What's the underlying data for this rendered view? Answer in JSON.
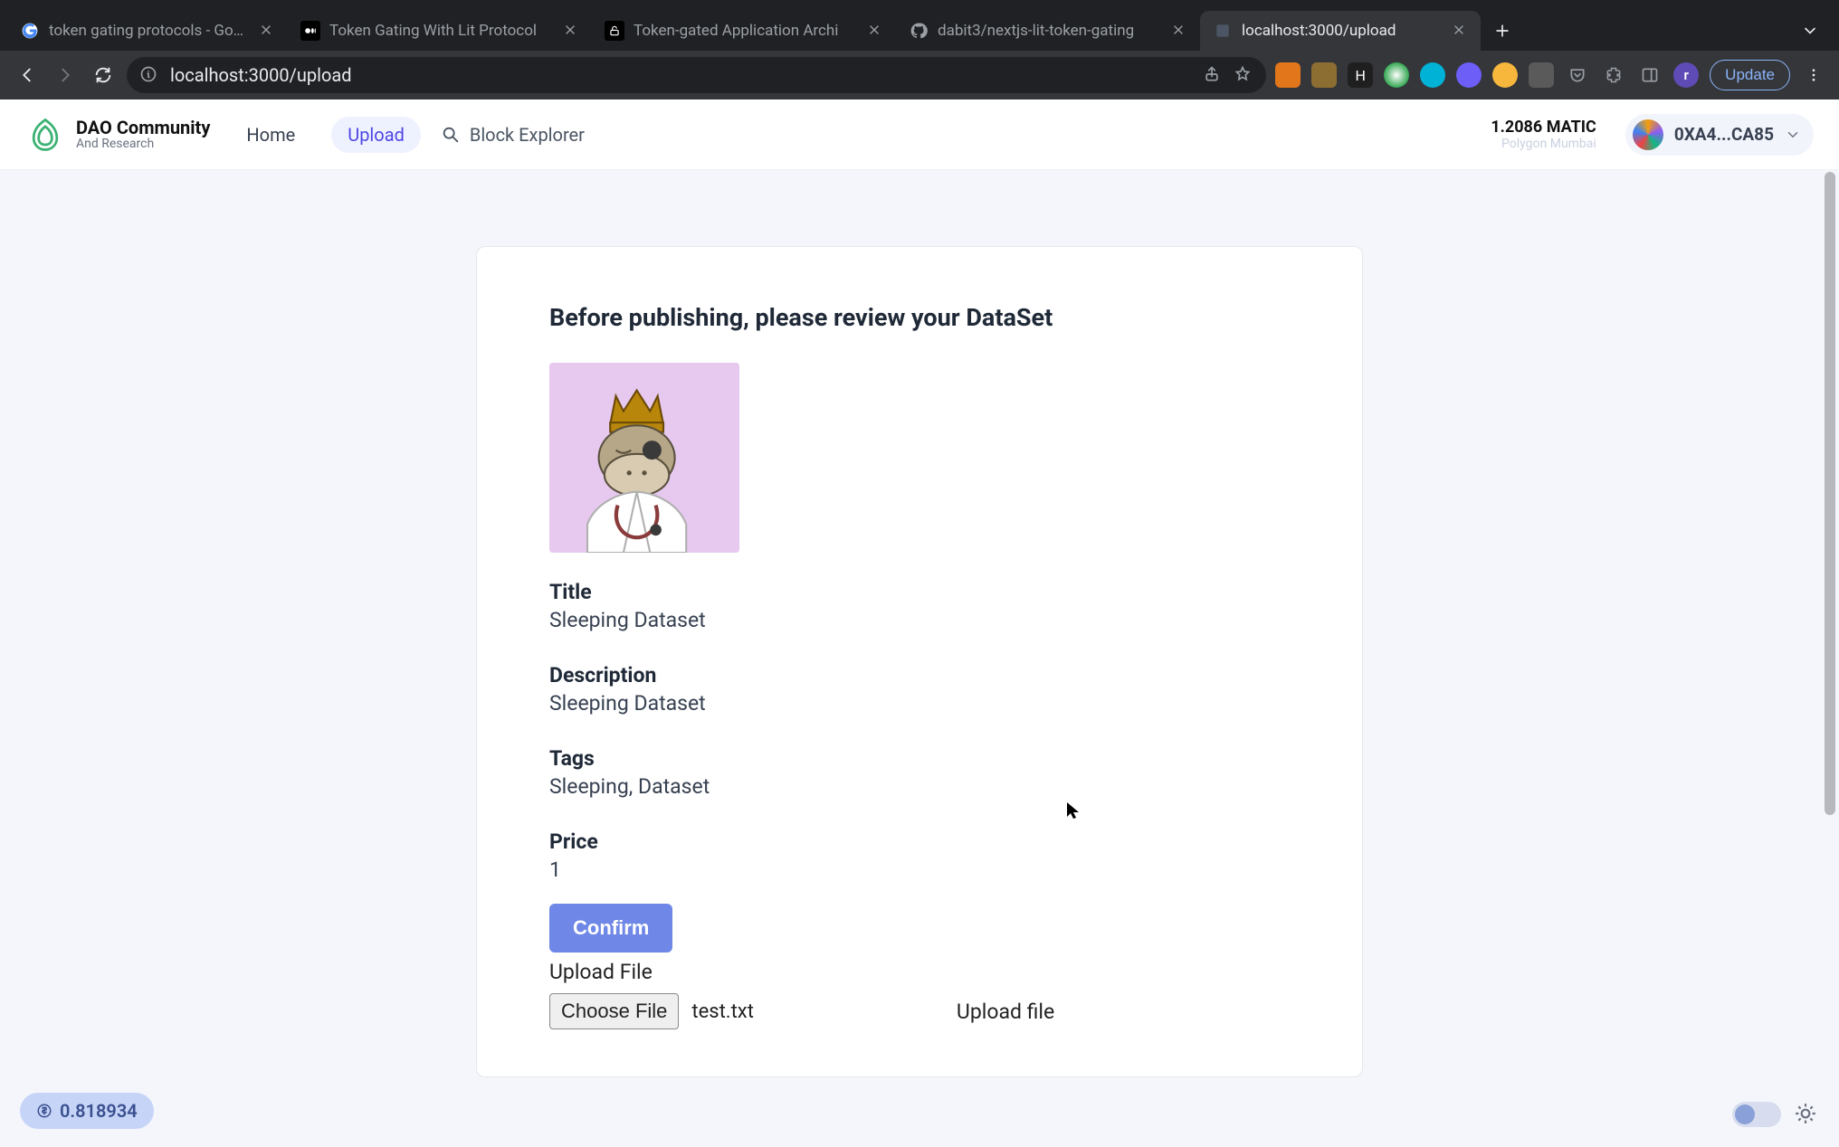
{
  "browser": {
    "tabs": [
      {
        "title": "token gating protocols - Goog"
      },
      {
        "title": "Token Gating With Lit Protocol"
      },
      {
        "title": "Token-gated Application Archi"
      },
      {
        "title": "dabit3/nextjs-lit-token-gating"
      },
      {
        "title": "localhost:3000/upload"
      }
    ],
    "url_host": "localhost:3000",
    "url_path": "/upload",
    "update_label": "Update"
  },
  "app": {
    "brand_line1": "DAO Community",
    "brand_line2": "And Research",
    "nav": {
      "home": "Home",
      "upload": "Upload",
      "search_placeholder": "Block Explorer"
    },
    "wallet": {
      "balance": "1.2086",
      "balance_unit": "MATIC",
      "network": "Polygon Mumbai",
      "address_short": "0XA4...CA85"
    }
  },
  "form": {
    "heading": "Before publishing, please review your DataSet",
    "title_label": "Title",
    "title_value": "Sleeping Dataset",
    "description_label": "Description",
    "description_value": "Sleeping Dataset",
    "tags_label": "Tags",
    "tags_value": "Sleeping, Dataset",
    "price_label": "Price",
    "price_value": "1",
    "confirm_label": "Confirm",
    "upload_file_label": "Upload File",
    "choose_file_label": "Choose File",
    "file_name": "test.txt",
    "upload_action_label": "Upload file"
  },
  "ticker": {
    "value": "0.818934"
  }
}
